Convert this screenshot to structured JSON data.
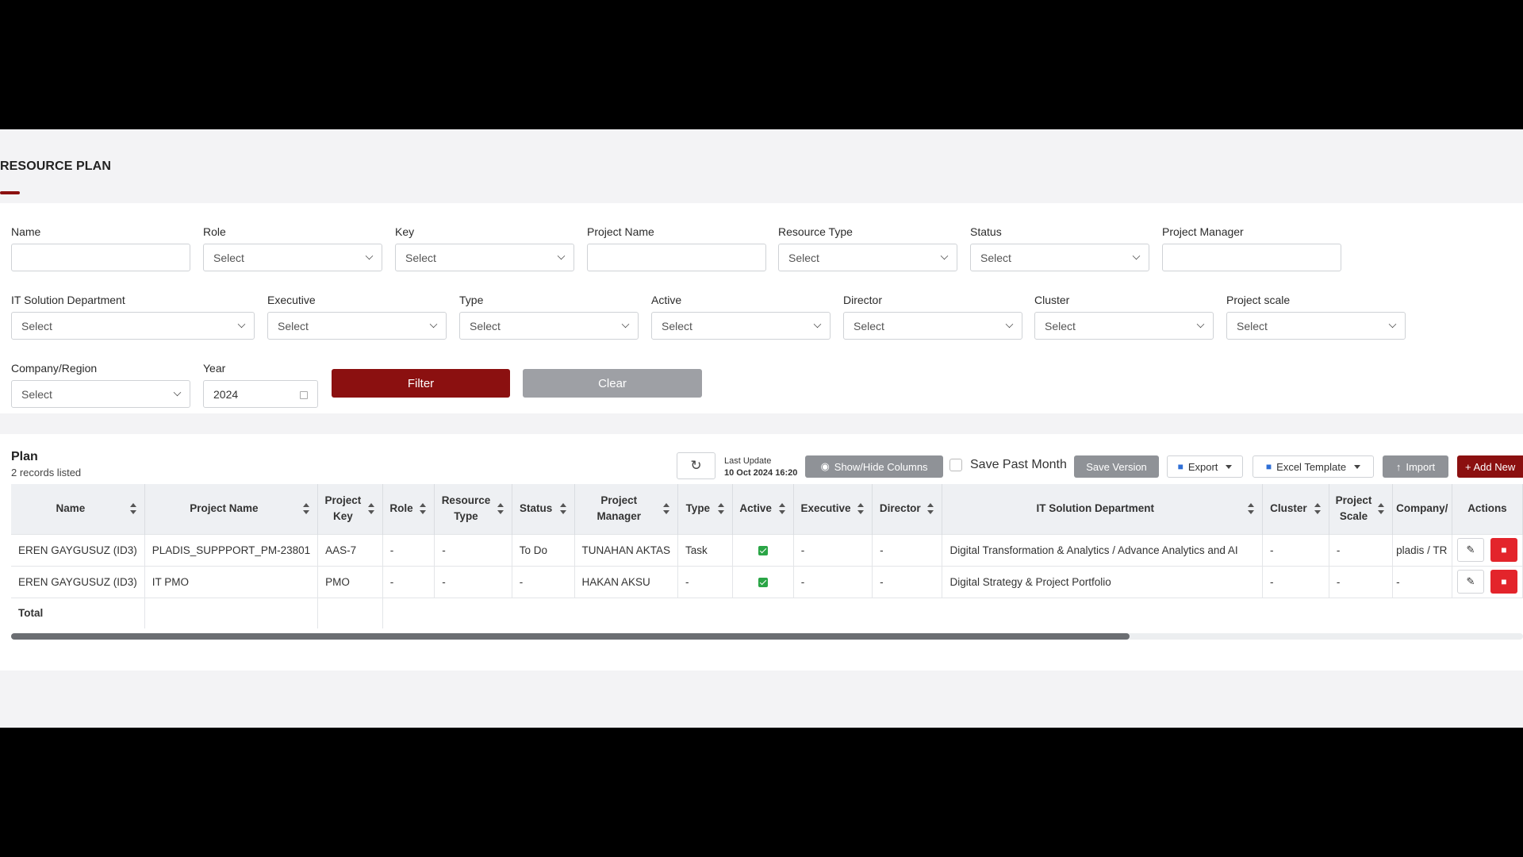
{
  "page": {
    "title": "RESOURCE PLAN"
  },
  "filters": {
    "select_placeholder": "Select",
    "name": {
      "label": "Name",
      "value": ""
    },
    "role": {
      "label": "Role",
      "value": "Select"
    },
    "key": {
      "label": "Key",
      "value": "Select"
    },
    "project_name": {
      "label": "Project Name",
      "value": ""
    },
    "resource_type": {
      "label": "Resource Type",
      "value": "Select"
    },
    "status": {
      "label": "Status",
      "value": "Select"
    },
    "project_manager": {
      "label": "Project Manager",
      "value": ""
    },
    "it_solution_department": {
      "label": "IT Solution Department",
      "value": "Select"
    },
    "executive": {
      "label": "Executive",
      "value": "Select"
    },
    "type": {
      "label": "Type",
      "value": "Select"
    },
    "active": {
      "label": "Active",
      "value": "Select"
    },
    "director": {
      "label": "Director",
      "value": "Select"
    },
    "cluster": {
      "label": "Cluster",
      "value": "Select"
    },
    "project_scale": {
      "label": "Project scale",
      "value": "Select"
    },
    "company_region": {
      "label": "Company/Region",
      "value": "Select"
    },
    "year": {
      "label": "Year",
      "value": "2024"
    },
    "filter_button": "Filter",
    "clear_button": "Clear"
  },
  "plan": {
    "title": "Plan",
    "count": "2 records listed",
    "refresh_icon": "refresh-icon",
    "last_update_label": "Last Update",
    "last_update_value": "10 Oct 2024 16:20",
    "show_hide_columns": "Show/Hide Columns",
    "save_past_month": "Save Past Month",
    "save_version": "Save Version",
    "export": "Export",
    "excel_template": "Excel Template",
    "import": "Import",
    "add_new": "+ Add New",
    "columns": {
      "name": "Name",
      "project_name": "Project Name",
      "project_key": "Project Key",
      "role": "Role",
      "resource_type": "Resource Type",
      "status": "Status",
      "project_manager": "Project Manager",
      "type": "Type",
      "active": "Active",
      "executive": "Executive",
      "director": "Director",
      "it_solution_department": "IT Solution Department",
      "cluster": "Cluster",
      "project_scale": "Project Scale",
      "company": "Company/",
      "actions": "Actions"
    },
    "rows": [
      {
        "name": "EREN GAYGUSUZ (ID3)",
        "project_name": "PLADIS_SUPPPORT_PM-23801",
        "project_key": "AAS-7",
        "role": "-",
        "resource_type": "-",
        "status": "To Do",
        "project_manager": "TUNAHAN AKTAS",
        "type": "Task",
        "active": "true",
        "executive": "-",
        "director": "-",
        "it_solution_department": "Digital Transformation & Analytics / Advance Analytics and AI",
        "cluster": "-",
        "project_scale": "-",
        "company": "pladis / TR"
      },
      {
        "name": "EREN GAYGUSUZ (ID3)",
        "project_name": "IT PMO",
        "project_key": "PMO",
        "role": "-",
        "resource_type": "-",
        "status": "-",
        "project_manager": "HAKAN AKSU",
        "type": "-",
        "active": "true",
        "executive": "-",
        "director": "-",
        "it_solution_department": "Digital Strategy & Project Portfolio",
        "cluster": "-",
        "project_scale": "-",
        "company": "-"
      }
    ],
    "total_label": "Total"
  },
  "colors": {
    "brand": "#8b1010",
    "delete": "#e3242b",
    "active_check": "#2aa546",
    "grey_button": "#8f9297"
  }
}
